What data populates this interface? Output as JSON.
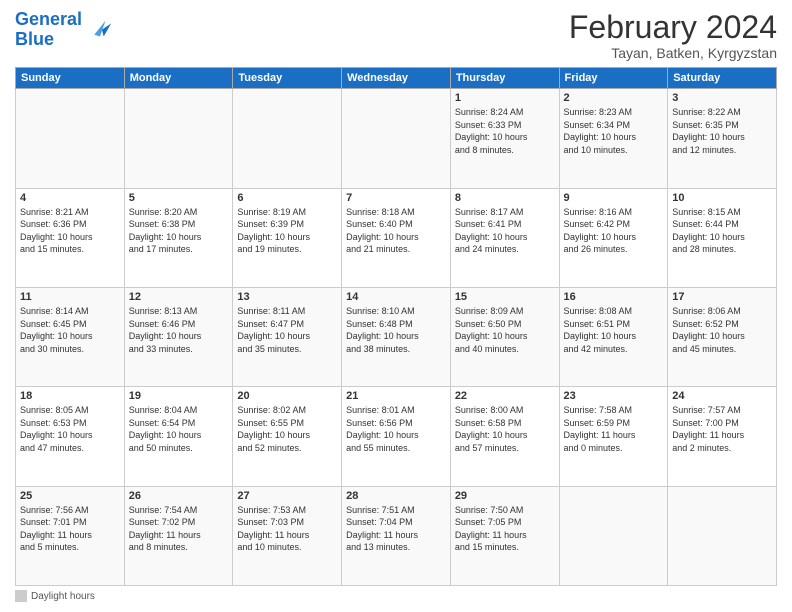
{
  "logo": {
    "line1": "General",
    "line2": "Blue"
  },
  "title": "February 2024",
  "subtitle": "Tayan, Batken, Kyrgyzstan",
  "days_of_week": [
    "Sunday",
    "Monday",
    "Tuesday",
    "Wednesday",
    "Thursday",
    "Friday",
    "Saturday"
  ],
  "weeks": [
    [
      {
        "num": "",
        "info": ""
      },
      {
        "num": "",
        "info": ""
      },
      {
        "num": "",
        "info": ""
      },
      {
        "num": "",
        "info": ""
      },
      {
        "num": "1",
        "info": "Sunrise: 8:24 AM\nSunset: 6:33 PM\nDaylight: 10 hours\nand 8 minutes."
      },
      {
        "num": "2",
        "info": "Sunrise: 8:23 AM\nSunset: 6:34 PM\nDaylight: 10 hours\nand 10 minutes."
      },
      {
        "num": "3",
        "info": "Sunrise: 8:22 AM\nSunset: 6:35 PM\nDaylight: 10 hours\nand 12 minutes."
      }
    ],
    [
      {
        "num": "4",
        "info": "Sunrise: 8:21 AM\nSunset: 6:36 PM\nDaylight: 10 hours\nand 15 minutes."
      },
      {
        "num": "5",
        "info": "Sunrise: 8:20 AM\nSunset: 6:38 PM\nDaylight: 10 hours\nand 17 minutes."
      },
      {
        "num": "6",
        "info": "Sunrise: 8:19 AM\nSunset: 6:39 PM\nDaylight: 10 hours\nand 19 minutes."
      },
      {
        "num": "7",
        "info": "Sunrise: 8:18 AM\nSunset: 6:40 PM\nDaylight: 10 hours\nand 21 minutes."
      },
      {
        "num": "8",
        "info": "Sunrise: 8:17 AM\nSunset: 6:41 PM\nDaylight: 10 hours\nand 24 minutes."
      },
      {
        "num": "9",
        "info": "Sunrise: 8:16 AM\nSunset: 6:42 PM\nDaylight: 10 hours\nand 26 minutes."
      },
      {
        "num": "10",
        "info": "Sunrise: 8:15 AM\nSunset: 6:44 PM\nDaylight: 10 hours\nand 28 minutes."
      }
    ],
    [
      {
        "num": "11",
        "info": "Sunrise: 8:14 AM\nSunset: 6:45 PM\nDaylight: 10 hours\nand 30 minutes."
      },
      {
        "num": "12",
        "info": "Sunrise: 8:13 AM\nSunset: 6:46 PM\nDaylight: 10 hours\nand 33 minutes."
      },
      {
        "num": "13",
        "info": "Sunrise: 8:11 AM\nSunset: 6:47 PM\nDaylight: 10 hours\nand 35 minutes."
      },
      {
        "num": "14",
        "info": "Sunrise: 8:10 AM\nSunset: 6:48 PM\nDaylight: 10 hours\nand 38 minutes."
      },
      {
        "num": "15",
        "info": "Sunrise: 8:09 AM\nSunset: 6:50 PM\nDaylight: 10 hours\nand 40 minutes."
      },
      {
        "num": "16",
        "info": "Sunrise: 8:08 AM\nSunset: 6:51 PM\nDaylight: 10 hours\nand 42 minutes."
      },
      {
        "num": "17",
        "info": "Sunrise: 8:06 AM\nSunset: 6:52 PM\nDaylight: 10 hours\nand 45 minutes."
      }
    ],
    [
      {
        "num": "18",
        "info": "Sunrise: 8:05 AM\nSunset: 6:53 PM\nDaylight: 10 hours\nand 47 minutes."
      },
      {
        "num": "19",
        "info": "Sunrise: 8:04 AM\nSunset: 6:54 PM\nDaylight: 10 hours\nand 50 minutes."
      },
      {
        "num": "20",
        "info": "Sunrise: 8:02 AM\nSunset: 6:55 PM\nDaylight: 10 hours\nand 52 minutes."
      },
      {
        "num": "21",
        "info": "Sunrise: 8:01 AM\nSunset: 6:56 PM\nDaylight: 10 hours\nand 55 minutes."
      },
      {
        "num": "22",
        "info": "Sunrise: 8:00 AM\nSunset: 6:58 PM\nDaylight: 10 hours\nand 57 minutes."
      },
      {
        "num": "23",
        "info": "Sunrise: 7:58 AM\nSunset: 6:59 PM\nDaylight: 11 hours\nand 0 minutes."
      },
      {
        "num": "24",
        "info": "Sunrise: 7:57 AM\nSunset: 7:00 PM\nDaylight: 11 hours\nand 2 minutes."
      }
    ],
    [
      {
        "num": "25",
        "info": "Sunrise: 7:56 AM\nSunset: 7:01 PM\nDaylight: 11 hours\nand 5 minutes."
      },
      {
        "num": "26",
        "info": "Sunrise: 7:54 AM\nSunset: 7:02 PM\nDaylight: 11 hours\nand 8 minutes."
      },
      {
        "num": "27",
        "info": "Sunrise: 7:53 AM\nSunset: 7:03 PM\nDaylight: 11 hours\nand 10 minutes."
      },
      {
        "num": "28",
        "info": "Sunrise: 7:51 AM\nSunset: 7:04 PM\nDaylight: 11 hours\nand 13 minutes."
      },
      {
        "num": "29",
        "info": "Sunrise: 7:50 AM\nSunset: 7:05 PM\nDaylight: 11 hours\nand 15 minutes."
      },
      {
        "num": "",
        "info": ""
      },
      {
        "num": "",
        "info": ""
      }
    ]
  ],
  "footer": {
    "label": "Daylight hours"
  }
}
